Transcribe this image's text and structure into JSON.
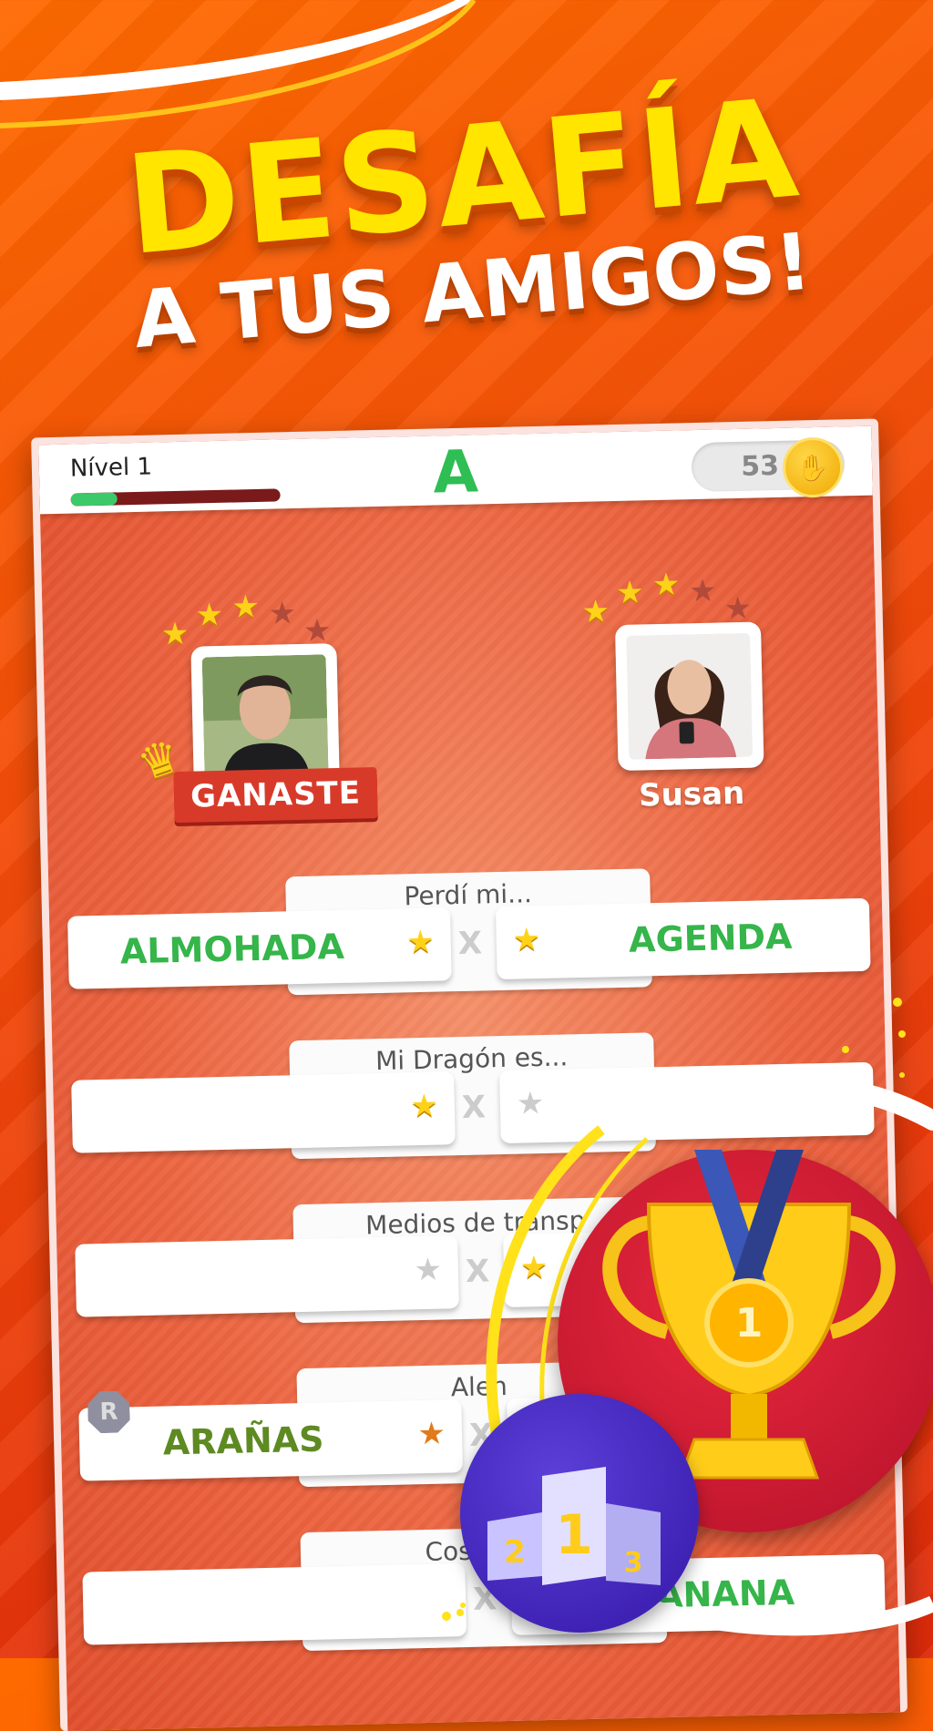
{
  "headline": {
    "line1": "DESAFÍA",
    "line2": "A TUS AMIGOS!"
  },
  "topbar": {
    "level_label": "Nível 1",
    "level_progress": 0.22,
    "letter": "A",
    "coins": "53",
    "coin_icon": "hand-coin-icon"
  },
  "players": {
    "me": {
      "stars_filled": 3,
      "stars_total": 5,
      "badge": "GANASTE",
      "crown_icon": "crown-icon"
    },
    "opponent": {
      "name": "Susan",
      "stars_filled": 3,
      "stars_total": 5
    }
  },
  "rounds": [
    {
      "category": "Perdí mi...",
      "left": "ALMOHADA",
      "right": "AGENDA",
      "vs": "X"
    },
    {
      "category": "Mi Dragón es...",
      "left": "",
      "right": "",
      "vs": "X"
    },
    {
      "category": "Medios de transp",
      "left": "",
      "right": "",
      "vs": "X"
    },
    {
      "category": "Alen",
      "left": "ARAÑAS",
      "right": "",
      "vs": "X",
      "badge": "R"
    },
    {
      "category": "Cosas de",
      "left": "",
      "right": "ANANA",
      "vs": "X"
    }
  ],
  "colors": {
    "accent_green": "#35b54a",
    "background_orange": "#f24a0a",
    "headline_yellow": "#ffe500"
  },
  "podium": {
    "labels": [
      "2",
      "1",
      "3"
    ]
  },
  "trophy": {
    "medal_number": "1"
  }
}
